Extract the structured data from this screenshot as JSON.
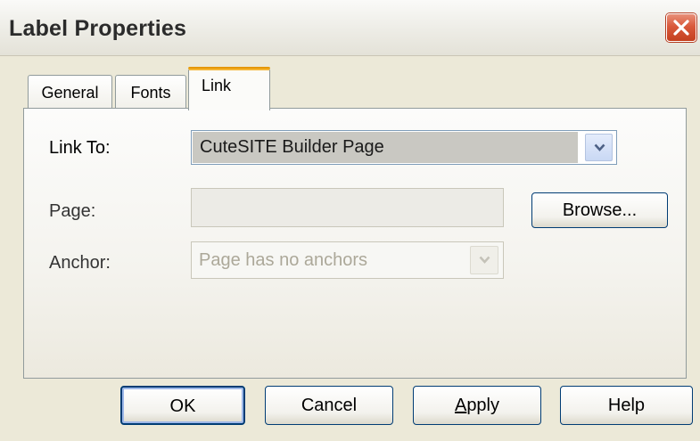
{
  "window": {
    "title": "Label Properties",
    "close_icon": "close-icon"
  },
  "tabs": [
    {
      "label": "General",
      "selected": false
    },
    {
      "label": "Fonts",
      "selected": false
    },
    {
      "label": "Link",
      "selected": true
    }
  ],
  "form": {
    "link_to": {
      "label": "Link To:",
      "value": "CuteSITE Builder Page"
    },
    "page": {
      "label": "Page:",
      "value": ""
    },
    "browse_button": "Browse...",
    "anchor": {
      "label": "Anchor:",
      "value": "Page has no anchors",
      "enabled": false
    }
  },
  "buttons": {
    "ok": "OK",
    "cancel": "Cancel",
    "apply_mnemonic": "A",
    "apply_rest": "pply",
    "help": "Help"
  },
  "colors": {
    "dialog_bg": "#ece9d8",
    "selected_tab_accent": "#f5b534",
    "close_button": "#d9593b",
    "button_border": "#003c74"
  }
}
